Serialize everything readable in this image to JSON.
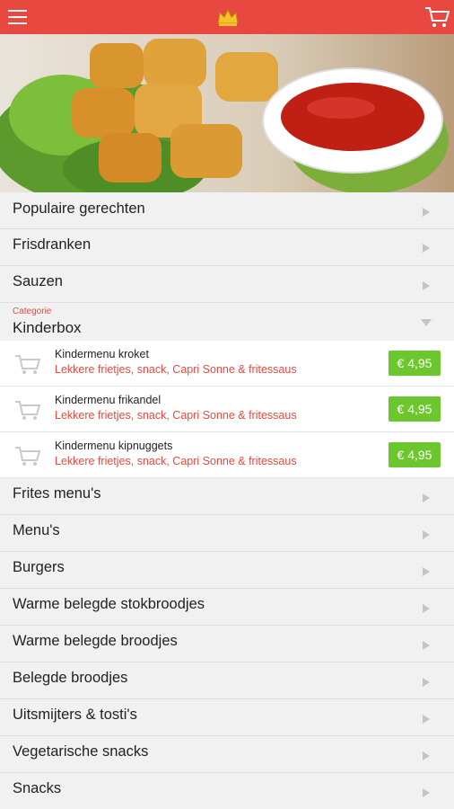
{
  "colors": {
    "primary": "#e8483f",
    "price_bg": "#6cc62e"
  },
  "header": {
    "menu_icon": "hamburger-icon",
    "logo_icon": "crown-logo",
    "cart_icon": "shopping-cart-icon"
  },
  "categories_top": [
    {
      "label": "Populaire gerechten"
    },
    {
      "label": "Frisdranken"
    },
    {
      "label": "Sauzen"
    }
  ],
  "expanded": {
    "caption": "Categorie",
    "title": "Kinderbox",
    "items": [
      {
        "name": "Kindermenu kroket",
        "desc": "Lekkere frietjes, snack, Capri Sonne & fritessaus",
        "price": "€ 4,95"
      },
      {
        "name": "Kindermenu frikandel",
        "desc": "Lekkere frietjes, snack, Capri Sonne & fritessaus",
        "price": "€ 4,95"
      },
      {
        "name": "Kindermenu kipnuggets",
        "desc": "Lekkere frietjes, snack, Capri Sonne & fritessaus",
        "price": "€ 4,95"
      }
    ]
  },
  "categories_bottom": [
    {
      "label": "Frites menu's"
    },
    {
      "label": "Menu's"
    },
    {
      "label": "Burgers"
    },
    {
      "label": "Warme belegde stokbroodjes"
    },
    {
      "label": "Warme belegde broodjes"
    },
    {
      "label": "Belegde broodjes"
    },
    {
      "label": "Uitsmijters & tosti's"
    },
    {
      "label": "Vegetarische snacks"
    },
    {
      "label": "Snacks"
    }
  ]
}
